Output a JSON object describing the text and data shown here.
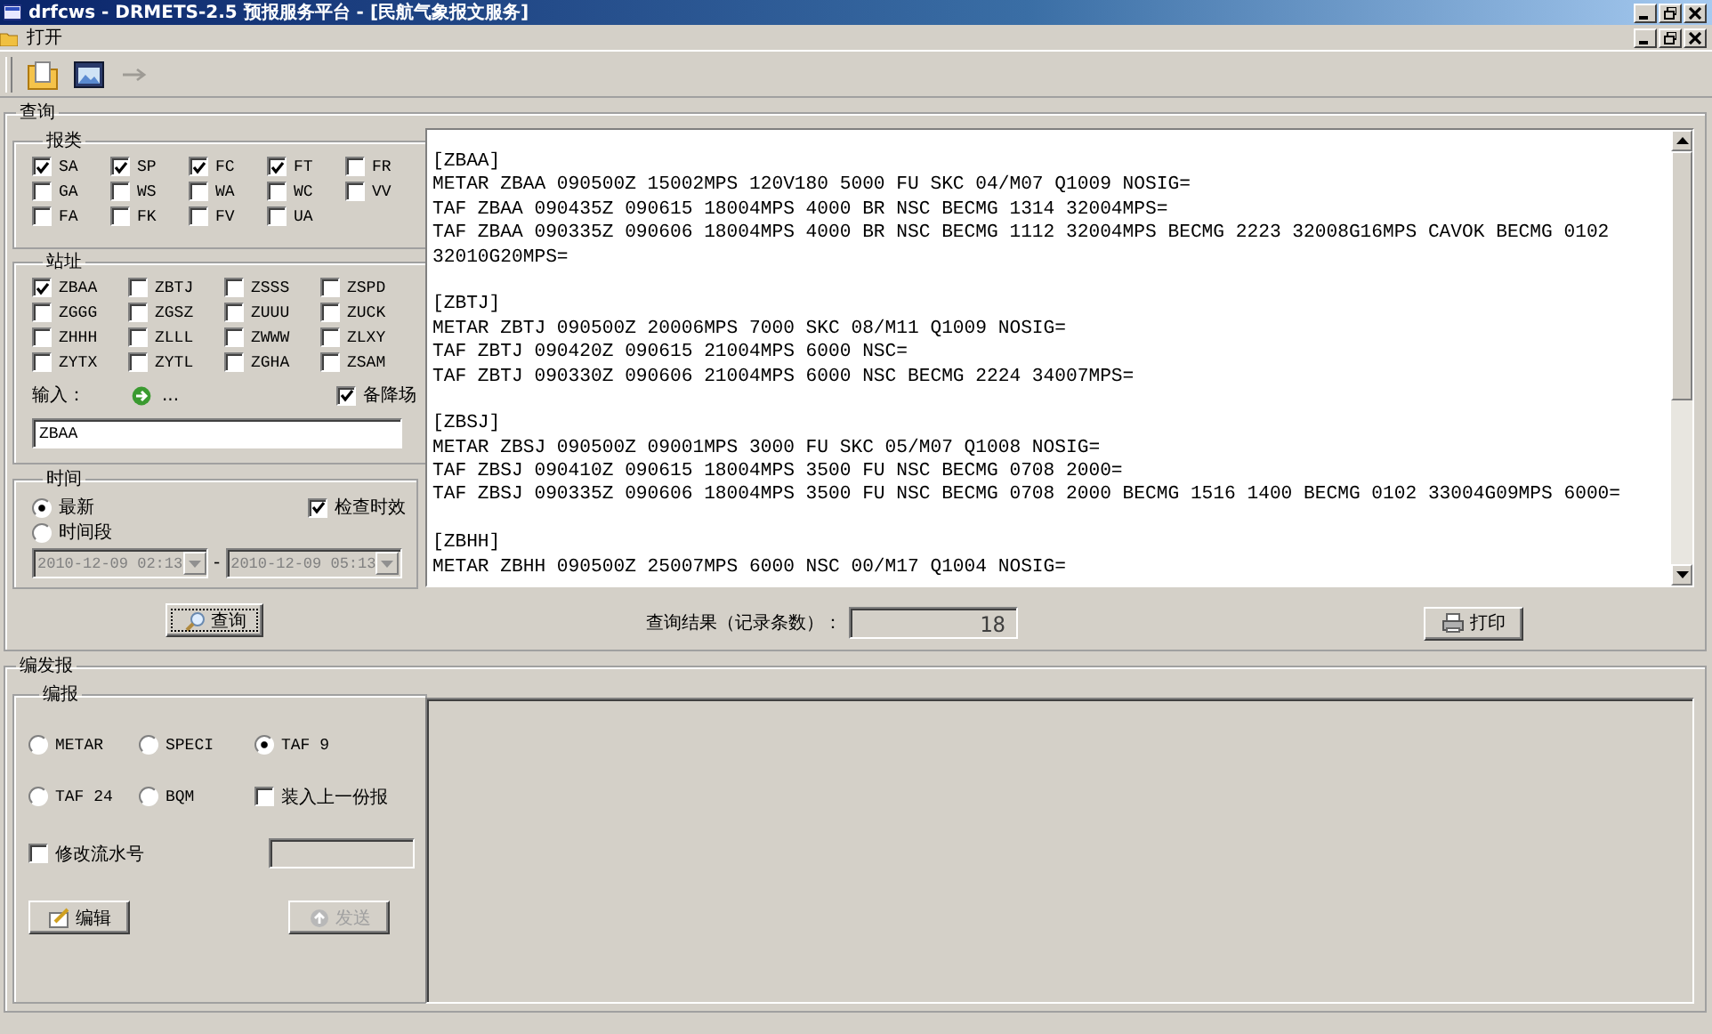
{
  "window": {
    "title": "drfcws - DRMETS-2.5 预报服务平台 - [民航气象报文服务]"
  },
  "menu": [
    {
      "label": "打开"
    }
  ],
  "toolbar": [
    {
      "kind": "folder",
      "disabled": false
    },
    {
      "kind": "window",
      "disabled": false
    },
    {
      "kind": "arrow",
      "disabled": true
    }
  ],
  "query": {
    "title": "查询",
    "report_types": {
      "title": "报类",
      "items": [
        {
          "label": "SA",
          "checked": true
        },
        {
          "label": "SP",
          "checked": true
        },
        {
          "label": "FC",
          "checked": true
        },
        {
          "label": "FT",
          "checked": true
        },
        {
          "label": "FR",
          "checked": false
        },
        {
          "label": "GA",
          "checked": false
        },
        {
          "label": "WS",
          "checked": false
        },
        {
          "label": "WA",
          "checked": false
        },
        {
          "label": "WC",
          "checked": false
        },
        {
          "label": "VV",
          "checked": false
        },
        {
          "label": "FA",
          "checked": false
        },
        {
          "label": "FK",
          "checked": false
        },
        {
          "label": "FV",
          "checked": false
        },
        {
          "label": "UA",
          "checked": false
        }
      ]
    },
    "stations": {
      "title": "站址",
      "items": [
        {
          "label": "ZBAA",
          "checked": true
        },
        {
          "label": "ZBTJ",
          "checked": false
        },
        {
          "label": "ZSSS",
          "checked": false
        },
        {
          "label": "ZSPD",
          "checked": false
        },
        {
          "label": "ZGGG",
          "checked": false
        },
        {
          "label": "ZGSZ",
          "checked": false
        },
        {
          "label": "ZUUU",
          "checked": false
        },
        {
          "label": "ZUCK",
          "checked": false
        },
        {
          "label": "ZHHH",
          "checked": false
        },
        {
          "label": "ZLLL",
          "checked": false
        },
        {
          "label": "ZWWW",
          "checked": false
        },
        {
          "label": "ZLXY",
          "checked": false
        },
        {
          "label": "ZYTX",
          "checked": false
        },
        {
          "label": "ZYTL",
          "checked": false
        },
        {
          "label": "ZGHA",
          "checked": false
        },
        {
          "label": "ZSAM",
          "checked": false
        }
      ],
      "input_label": "输入：",
      "more": "...",
      "alternate": {
        "label": "备降场",
        "checked": true
      },
      "input_value": "ZBAA"
    },
    "time": {
      "title": "时间",
      "options": [
        {
          "label": "最新",
          "selected": true
        },
        {
          "label": "时间段",
          "selected": false
        }
      ],
      "check_validity": {
        "label": "检查时效",
        "checked": true
      },
      "start": "2010-12-09 02:13",
      "separator": "-",
      "end": "2010-12-09 05:13",
      "disabled": true
    },
    "query_button": "查询",
    "result_blocks": [
      {
        "lines": [
          "[ZBAA]",
          "METAR ZBAA 090500Z 15002MPS 120V180 5000 FU SKC 04/M07 Q1009 NOSIG=",
          "TAF ZBAA 090435Z 090615 18004MPS 4000 BR NSC BECMG 1314 32004MPS=",
          "TAF ZBAA 090335Z 090606 18004MPS 4000 BR NSC BECMG 1112 32004MPS BECMG 2223 32008G16MPS CAVOK BECMG 0102",
          "32010G20MPS="
        ]
      },
      {
        "lines": [
          "[ZBTJ]",
          "METAR ZBTJ 090500Z 20006MPS 7000 SKC 08/M11 Q1009 NOSIG=",
          "TAF ZBTJ 090420Z 090615 21004MPS 6000 NSC=",
          "TAF ZBTJ 090330Z 090606 21004MPS 6000 NSC BECMG 2224 34007MPS="
        ]
      },
      {
        "lines": [
          "[ZBSJ]",
          "METAR ZBSJ 090500Z 09001MPS 3000 FU SKC 05/M07 Q1008 NOSIG=",
          "TAF ZBSJ 090410Z 090615 18004MPS 3500 FU NSC BECMG 0708 2000=",
          "TAF ZBSJ 090335Z 090606 18004MPS 3500 FU NSC BECMG 0708 2000 BECMG 1516 1400 BECMG 0102 33004G09MPS 6000="
        ]
      },
      {
        "lines": [
          "[ZBHH]",
          "METAR ZBHH 090500Z 25007MPS 6000 NSC 00/M17 Q1004 NOSIG="
        ]
      }
    ],
    "result_label": "查询结果（记录条数）：",
    "result_count": "18",
    "print_button": "打印"
  },
  "compose": {
    "title": "编发报",
    "group_title": "编报",
    "options": [
      {
        "kind": "radio",
        "label": "METAR",
        "selected": false
      },
      {
        "kind": "radio",
        "label": "SPECI",
        "selected": false
      },
      {
        "kind": "radio",
        "label": "TAF 9",
        "selected": true
      },
      {
        "kind": "radio",
        "label": "TAF 24",
        "selected": false
      },
      {
        "kind": "radio",
        "label": "BQM",
        "selected": false
      },
      {
        "kind": "checkbox",
        "label": "装入上一份报",
        "checked": false
      }
    ],
    "serial": {
      "label": "修改流水号",
      "checked": false
    },
    "edit_button": "编辑",
    "send_button": {
      "label": "发送",
      "disabled": true
    }
  }
}
